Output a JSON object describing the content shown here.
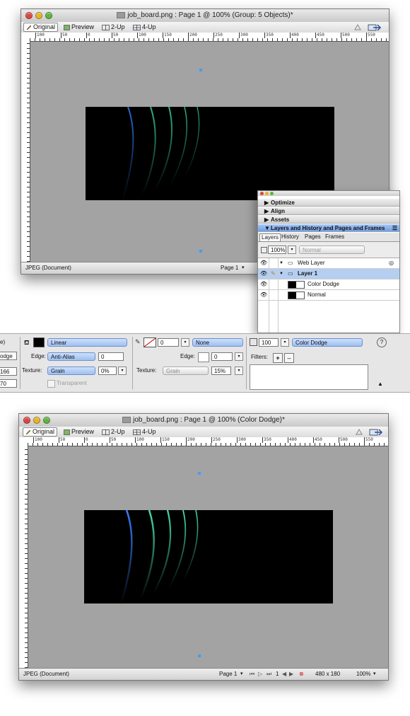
{
  "window1": {
    "title": "job_board.png : Page 1 @ 100% (Group: 5 Objects)*",
    "tabs": [
      "Original",
      "Preview",
      "2-Up",
      "4-Up"
    ],
    "ruler_ticks": [
      "100",
      "50",
      "0",
      "50",
      "100",
      "150",
      "200",
      "250",
      "300",
      "350",
      "400",
      "450",
      "500",
      "550"
    ],
    "status_left": "JPEG (Document)",
    "page_label": "Page 1"
  },
  "panel": {
    "sections": [
      "Optimize",
      "Align",
      "Assets",
      "Layers and History and Pages and Frames"
    ],
    "tabs": [
      "Layers",
      "History",
      "Pages",
      "Frames"
    ],
    "opacity": "100%",
    "blend": "Normal",
    "layers": [
      "Web Layer",
      "Layer 1",
      "Color Dodge",
      "Normal"
    ]
  },
  "props": {
    "partial_top": "e)",
    "partial_dge": "odge",
    "partial_w": "166",
    "partial_h": "70",
    "fill_type": "Linear",
    "edge_label": "Edge:",
    "edge_value": "Anti-Alias",
    "edge_amount": "0",
    "texture_label": "Texture:",
    "texture_value": "Grain",
    "texture_pct": "0%",
    "transparent_label": "Transparent",
    "stroke_size": "0",
    "stroke_type": "None",
    "stroke_edge_label": "Edge:",
    "stroke_edge_amount": "0",
    "stroke_texture_label": "Texture:",
    "stroke_texture_value": "Grain",
    "stroke_texture_pct": "15%",
    "opacity": "100",
    "blend": "Color Dodge",
    "filters_label": "Filters:",
    "add_label": "+",
    "remove_label": "–",
    "help_label": "?"
  },
  "window2": {
    "title": "job_board.png : Page 1 @ 100% (Color Dodge)*",
    "tabs": [
      "Original",
      "Preview",
      "2-Up",
      "4-Up"
    ],
    "ruler_ticks": [
      "100",
      "50",
      "0",
      "50",
      "100",
      "150",
      "200",
      "250",
      "300",
      "350",
      "400",
      "450",
      "500",
      "550"
    ],
    "status_left": "JPEG (Document)",
    "page_label": "Page 1",
    "page_num": "1",
    "size": "480 x 180",
    "zoom": "100%"
  },
  "colors": {
    "canvas_bg": "#a3a3a3",
    "art_bg": "#000000",
    "accent_selection": "#b5cff3",
    "marker": "#39a0ff"
  }
}
